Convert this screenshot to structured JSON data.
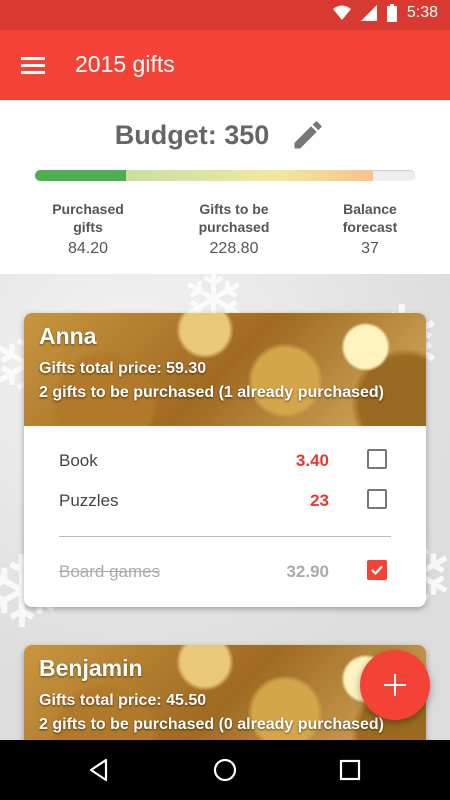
{
  "status_bar": {
    "time": "5:38"
  },
  "app_bar": {
    "title": "2015 gifts"
  },
  "budget": {
    "title": "Budget: 350",
    "purchased_fraction": 0.24,
    "to_be_purchased_fraction": 0.65,
    "stats": [
      {
        "label_line1": "Purchased",
        "label_line2": "gifts",
        "value": "84.20"
      },
      {
        "label_line1": "Gifts to be",
        "label_line2": "purchased",
        "value": "228.80"
      },
      {
        "label_line1": "Balance",
        "label_line2": "forecast",
        "value": "37"
      }
    ]
  },
  "people": [
    {
      "name": "Anna",
      "total": "Gifts total price: 59.30",
      "summary": "2 gifts to be purchased (1 already purchased)",
      "gifts": [
        {
          "name": "Book",
          "price": "3.40",
          "purchased": false
        },
        {
          "name": "Puzzles",
          "price": "23",
          "purchased": false
        },
        {
          "name": "Board games",
          "price": "32.90",
          "purchased": true
        }
      ]
    },
    {
      "name": "Benjamin",
      "total": "Gifts total price: 45.50",
      "summary": "2 gifts to be purchased (0 already purchased)"
    }
  ],
  "icons": {
    "menu": "menu-icon",
    "edit": "pencil-icon",
    "fab": "plus-icon",
    "nav_back": "back-triangle-icon",
    "nav_home": "home-circle-icon",
    "nav_recents": "recents-square-icon"
  },
  "colors": {
    "primary": "#f44336",
    "status": "#d83a31",
    "price": "#e53935"
  }
}
